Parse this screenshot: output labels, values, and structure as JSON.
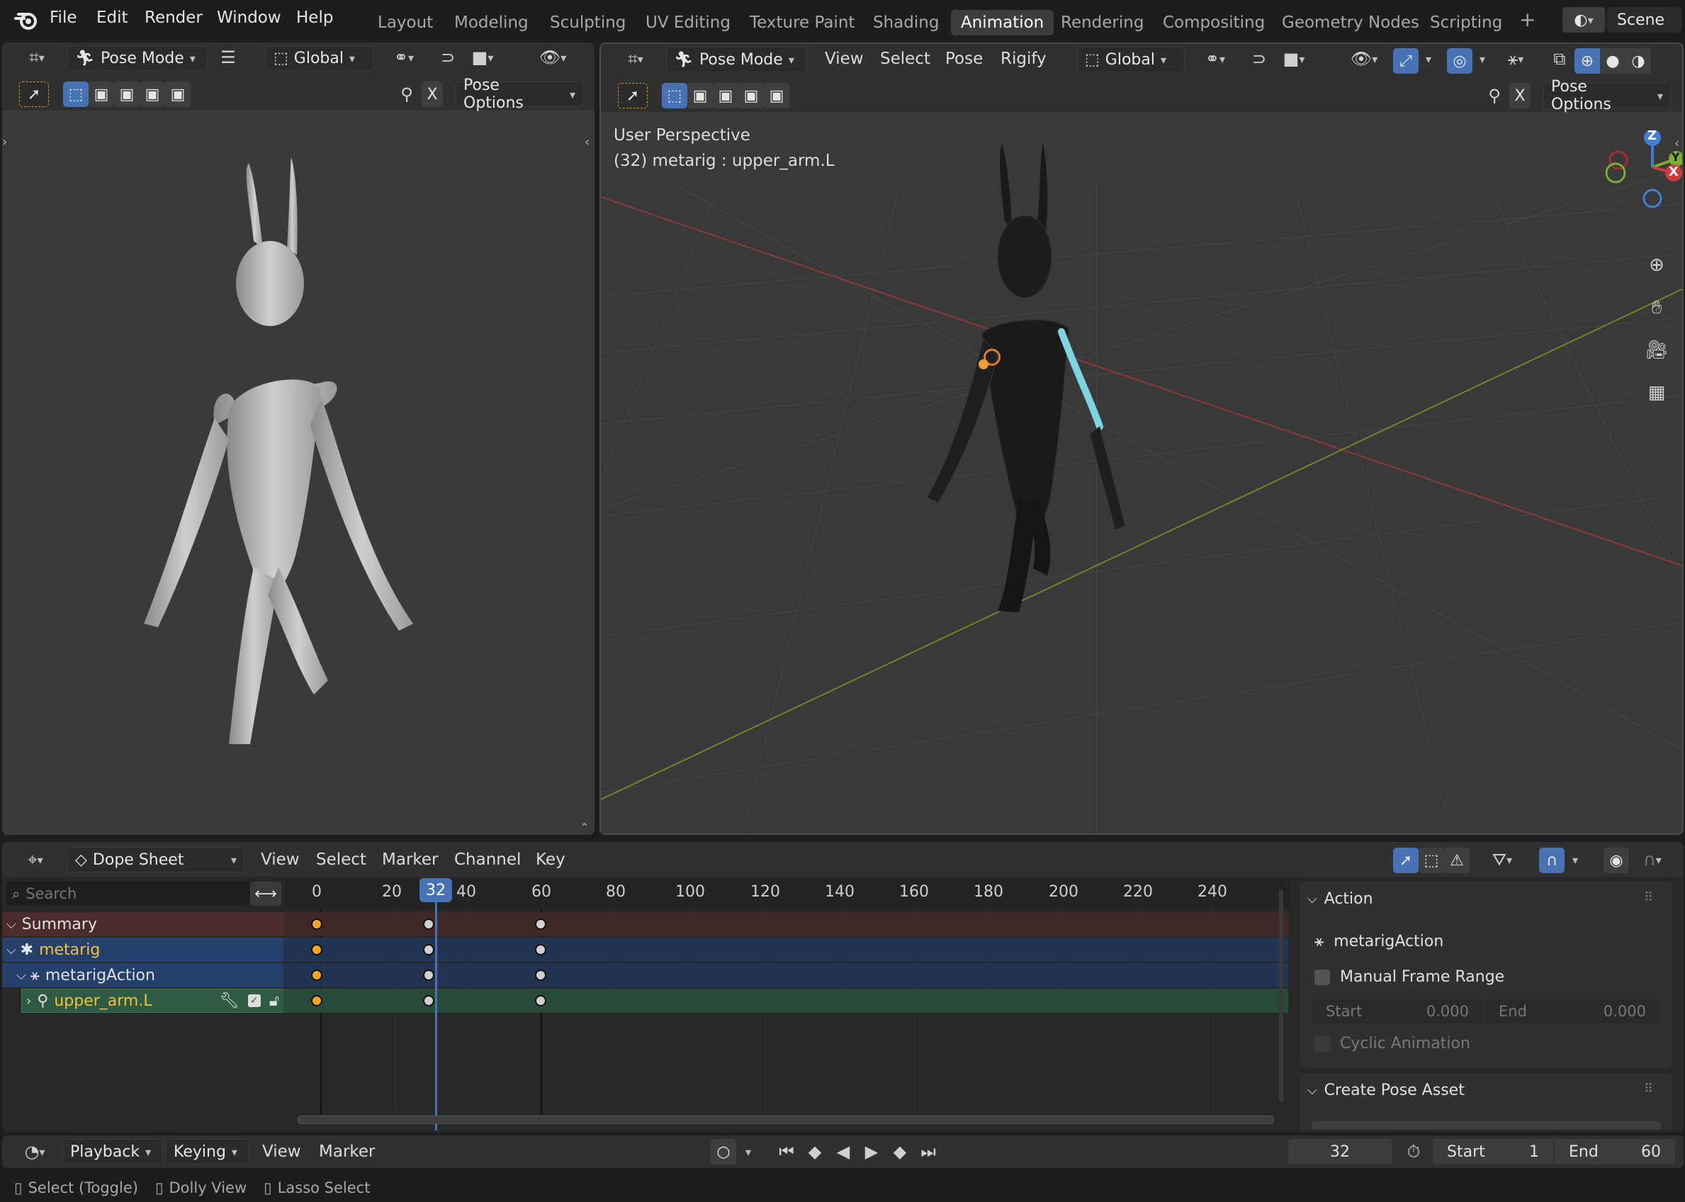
{
  "topbar": {
    "menus": [
      "File",
      "Edit",
      "Render",
      "Window",
      "Help"
    ],
    "workspaces": [
      "Layout",
      "Modeling",
      "Sculpting",
      "UV Editing",
      "Texture Paint",
      "Shading",
      "Animation",
      "Rendering",
      "Compositing",
      "Geometry Nodes",
      "Scripting"
    ],
    "active_workspace": "Animation",
    "scene": "Scene"
  },
  "left_view": {
    "mode": "Pose Mode",
    "orientation": "Global",
    "x_label": "X",
    "pose_options": "Pose Options"
  },
  "right_view": {
    "mode": "Pose Mode",
    "menus": [
      "View",
      "Select",
      "Pose",
      "Rigify"
    ],
    "orientation": "Global",
    "x_label": "X",
    "pose_options": "Pose Options",
    "overlay_line1": "User Perspective",
    "overlay_line2": "(32) metarig : upper_arm.L",
    "gizmo": {
      "z": "Z",
      "y": "Y",
      "x": "X"
    }
  },
  "dopesheet": {
    "editor": "Dope Sheet",
    "menus": [
      "View",
      "Select",
      "Marker",
      "Channel",
      "Key"
    ],
    "search_placeholder": "Search",
    "current_frame": "32",
    "ticks": [
      "0",
      "20",
      "40",
      "60",
      "80",
      "100",
      "120",
      "140",
      "160",
      "180",
      "200",
      "220",
      "240"
    ],
    "channels": {
      "summary": "Summary",
      "object": "metarig",
      "action": "metarigAction",
      "bone": "upper_arm.L"
    },
    "keyframes": [
      0,
      30,
      60
    ]
  },
  "sidebar": {
    "action_title": "Action",
    "action_name": "metarigAction",
    "manual_range": "Manual Frame Range",
    "start_label": "Start",
    "start_value": "0.000",
    "end_label": "End",
    "end_value": "0.000",
    "cyclic": "Cyclic Animation",
    "pose_asset_title": "Create Pose Asset"
  },
  "timeline": {
    "menus": [
      "Playback",
      "Keying",
      "View",
      "Marker"
    ],
    "frame": "32",
    "start_label": "Start",
    "start_value": "1",
    "end_label": "End",
    "end_value": "60"
  },
  "statusbar": {
    "items": [
      "Select (Toggle)",
      "Dolly View",
      "Lasso Select"
    ]
  },
  "colors": {
    "accent": "#4772b3",
    "summary_bg": "#4a2c2c",
    "object_bg": "#25406b",
    "bone_bg": "#2f5a43",
    "key_selected": "#f5a623",
    "key_default": "#d0d0d0"
  }
}
